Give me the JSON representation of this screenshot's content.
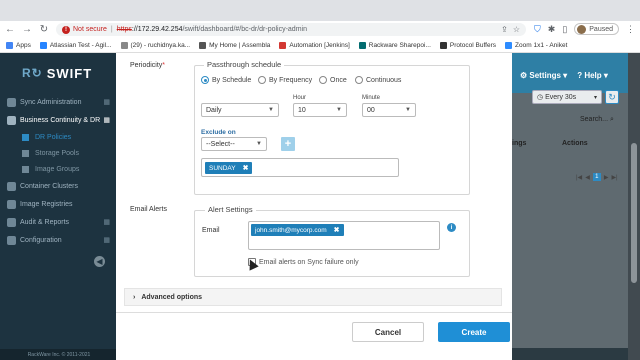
{
  "browser": {
    "not_secure": "Not secure",
    "url_proto": "https",
    "url_host": "://172.29.42.254",
    "url_path": "/swift/dashboard/#/bc-dr/dr-policy-admin",
    "profile_status": "Paused"
  },
  "bookmarks": [
    {
      "label": "Apps",
      "color": "#4285f4"
    },
    {
      "label": "Atlassian Test - Agil...",
      "color": "#2684ff"
    },
    {
      "label": "(29) - ruchidnya.ka...",
      "color": "#888888"
    },
    {
      "label": "My Home | Assembla",
      "color": "#555555"
    },
    {
      "label": "Automation [Jenkins]",
      "color": "#d33833"
    },
    {
      "label": "Rackware Sharepoi...",
      "color": "#036c70"
    },
    {
      "label": "Protocol Buffers",
      "color": "#333333"
    },
    {
      "label": "Zoom 1x1 - Aniket",
      "color": "#2d8cff"
    }
  ],
  "app": {
    "logo": "SWIFT",
    "copyright": "RackWare Inc. © 2011-2021",
    "topbar": {
      "settings": "⚙ Settings ▾",
      "help": "? Help ▾"
    },
    "refresh_select": "Every 30s",
    "search_label": "Search...",
    "table_cols": [
      "ings",
      "Actions"
    ],
    "pager": [
      "|◀",
      "◀",
      "1",
      "▶",
      "▶|"
    ]
  },
  "sidebar": [
    {
      "label": "Sync Administration",
      "active": false
    },
    {
      "label": "Business Continuity & DR",
      "active": true
    }
  ],
  "sidebar_sub": [
    {
      "label": "DR Policies",
      "current": true
    },
    {
      "label": "Storage Pools",
      "current": false
    },
    {
      "label": "Image Groups",
      "current": false
    }
  ],
  "sidebar_more": [
    {
      "label": "Container Clusters"
    },
    {
      "label": "Image Registries"
    },
    {
      "label": "Audit & Reports"
    },
    {
      "label": "Configuration"
    }
  ],
  "form": {
    "periodicity_label": "Periodicity",
    "required_mark": "*",
    "passthrough_legend": "Passthrough schedule",
    "radios": [
      {
        "label": "By Schedule",
        "checked": true
      },
      {
        "label": "By Frequency",
        "checked": false
      },
      {
        "label": "Once",
        "checked": false
      },
      {
        "label": "Continuous",
        "checked": false
      }
    ],
    "hour_label": "Hour",
    "minute_label": "Minute",
    "frequency_value": "Daily",
    "hour_value": "10",
    "minute_value": "00",
    "exclude_on_label": "Exclude on",
    "exclude_select_value": "--Select--",
    "plus": "+",
    "excluded_days": [
      {
        "label": "SUNDAY",
        "remove": "✖"
      }
    ],
    "email_alerts_label": "Email Alerts",
    "alert_settings_legend": "Alert Settings",
    "email_label": "Email",
    "emails": [
      {
        "label": "john.smith@mycorp.com",
        "remove": "✖"
      }
    ],
    "info": "i",
    "sync_failure_only_label": "Email alerts on Sync failure only",
    "advanced_label": "Advanced options",
    "advanced_chevron": "›",
    "cancel_label": "Cancel",
    "create_label": "Create"
  }
}
